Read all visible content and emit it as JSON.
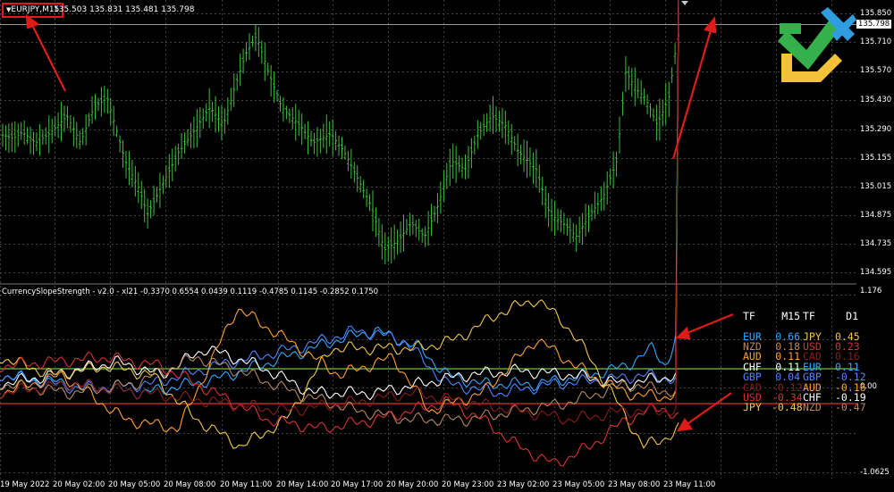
{
  "window": {
    "symbol": "EURJPY,M15",
    "ohlc": "135.503 135.831 135.481 135.798"
  },
  "indicator": {
    "title": "CurrencySlopeStrength - v2.0 - xl21 -0.3370 0.6554 0.0439 0.1119 -0.4785 0.1145 -0.2852 0.1750"
  },
  "price_axis": {
    "labels": [
      "135.850",
      "135.710",
      "135.570",
      "135.430",
      "135.290",
      "135.155",
      "135.015",
      "134.875",
      "134.735",
      "134.595"
    ],
    "current": "135.798"
  },
  "indicator_axis": {
    "labels": [
      "1.176",
      "0.00",
      "-1.0625"
    ]
  },
  "time_axis": {
    "labels": [
      "19 May 2022",
      "20 May 02:00",
      "20 May 05:00",
      "20 May 08:00",
      "20 May 11:00",
      "20 May 14:00",
      "20 May 17:00",
      "20 May 20:00",
      "20 May 23:00",
      "23 May 02:00",
      "23 May 05:00",
      "23 May 08:00",
      "23 May 11:00"
    ]
  },
  "strength_table": {
    "headers": [
      "TF",
      "M15",
      "TF",
      "D1"
    ],
    "rows": [
      {
        "l": "EUR",
        "lv": "0.66",
        "lc": "#2fa8ff",
        "r": "JPY",
        "rv": "0.45",
        "rc": "#f2c74a"
      },
      {
        "l": "NZD",
        "lv": "0.18",
        "lc": "#b88a5a",
        "r": "USD",
        "rv": "0.23",
        "rc": "#d83232"
      },
      {
        "l": "AUD",
        "lv": "0.11",
        "lc": "#ffa030",
        "r": "CAD",
        "rv": "0.16",
        "rc": "#8c1c1c"
      },
      {
        "l": "CHF",
        "lv": "0.11",
        "lc": "#ffffff",
        "r": "EUR",
        "rv": "0.11",
        "rc": "#2fa8ff"
      },
      {
        "l": "GBP",
        "lv": "0.04",
        "lc": "#4f86ff",
        "r": "GBP",
        "rv": "-0.12",
        "rc": "#4f86ff"
      },
      {
        "l": "CAD",
        "lv": "-0.12",
        "lc": "#8c1c1c",
        "r": "AUD",
        "rv": "-0.16",
        "rc": "#ffa030"
      },
      {
        "l": "USD",
        "lv": "-0.34",
        "lc": "#d83232",
        "r": "CHF",
        "rv": "-0.19",
        "rc": "#ffffff"
      },
      {
        "l": "JPY",
        "lv": "-0.48",
        "lc": "#f2c74a",
        "r": "NZD",
        "rv": "-0.47",
        "rc": "#b88a5a"
      }
    ]
  },
  "colors": {
    "background": "#000000",
    "candle": "#3cbf3c",
    "grid": "#5a5a5a",
    "annotation": "#e01b1b",
    "level_green": "#6cc24a",
    "level_red": "#e03030"
  }
}
